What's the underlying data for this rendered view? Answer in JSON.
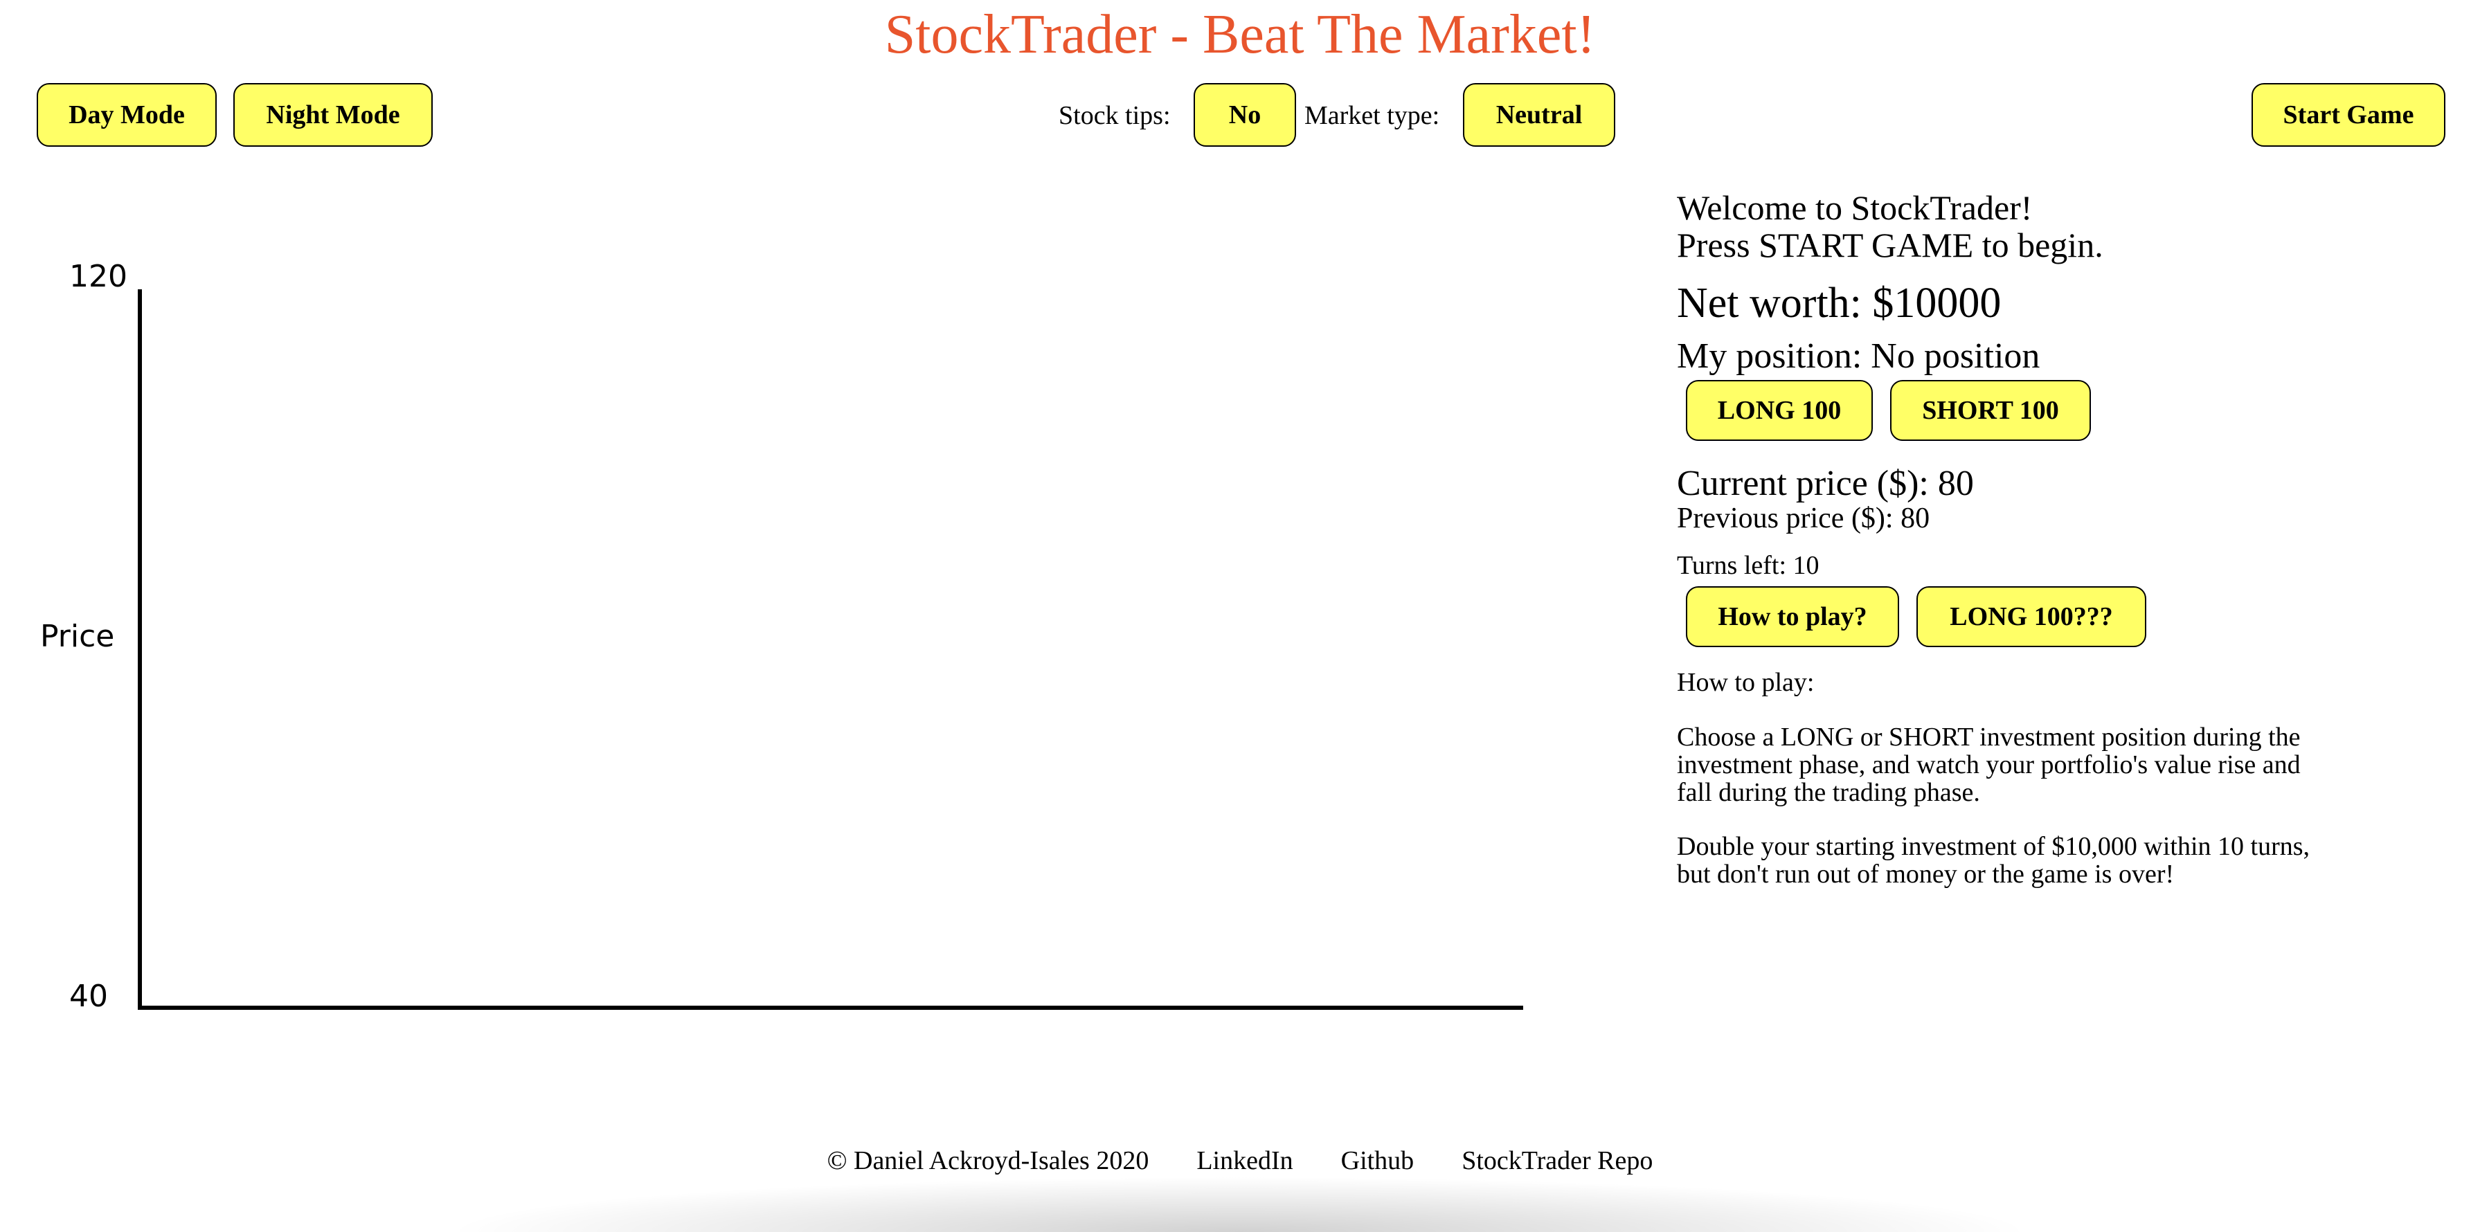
{
  "app": {
    "title": "StockTrader - Beat The Market!"
  },
  "toolbar": {
    "day_mode": "Day Mode",
    "night_mode": "Night Mode",
    "stock_tips_label": "Stock tips:",
    "stock_tips_value": "No",
    "market_type_label": "Market type:",
    "market_type_value": "Neutral",
    "start_game": "Start Game"
  },
  "chart_data": {
    "type": "line",
    "title": "",
    "ylabel": "Price",
    "xlabel": "",
    "ylim": [
      40,
      120
    ],
    "y_ticks": [
      "120",
      "40"
    ],
    "series": [],
    "grid": false
  },
  "panel": {
    "welcome_line1": "Welcome to StockTrader!",
    "welcome_line2": "Press START GAME to begin.",
    "net_worth": "Net worth: $10000",
    "position": "My position: No position",
    "long_button": "LONG 100",
    "short_button": "SHORT 100",
    "current_price": "Current price ($): 80",
    "previous_price": "Previous price ($): 80",
    "turns_left": "Turns left: 10",
    "how_to_play_button": "How to play?",
    "long_q_button": "LONG 100???",
    "how_to_play_heading": "How to play:",
    "how_to_play_p1_l1": "Choose a LONG or SHORT investment position during the",
    "how_to_play_p1_l2": "investment phase, and watch your portfolio's value rise and",
    "how_to_play_p1_l3": "fall during the trading phase.",
    "how_to_play_p2_l1": "Double your starting investment of $10,000 within 10 turns,",
    "how_to_play_p2_l2": "but don't run out of money or the game is over!"
  },
  "footer": {
    "copyright": "© Daniel Ackroyd-Isales 2020",
    "linkedin": "LinkedIn",
    "github": "Github",
    "repo": "StockTrader Repo"
  },
  "colors": {
    "title": "#e8552d",
    "button": "#ffff66",
    "border": "#000000"
  }
}
